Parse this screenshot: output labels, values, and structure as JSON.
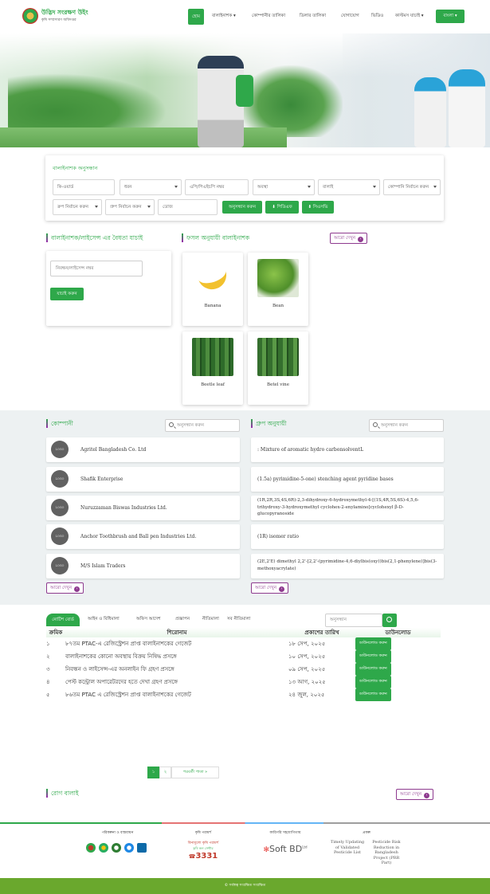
{
  "header": {
    "logo_title": "উদ্ভিদ সংরক্ষণ উইং",
    "logo_subtitle": "কৃষি সম্প্রসারণ অধিদপ্তর",
    "nav": [
      {
        "label": "হোম",
        "active": true
      },
      {
        "label": "বালাইনাশক ▾"
      },
      {
        "label": "কোম্পানীর তালিকা"
      },
      {
        "label": "ডিলার তালিকা"
      },
      {
        "label": "যোগাযোগ"
      },
      {
        "label": "ভিডিও"
      },
      {
        "label": "কাস্টমস যাচাই ▾"
      }
    ],
    "lang_button": "বাংলা ▾"
  },
  "search_panel": {
    "title": "বালাইনাশক অনুসন্ধান",
    "row1": [
      {
        "value": "কি-ওয়ার্ড",
        "dropdown": false
      },
      {
        "value": "ধরন",
        "dropdown": true
      },
      {
        "value": "এপি/পিএইচপি নম্বর",
        "dropdown": false
      },
      {
        "value": "অবস্থা",
        "dropdown": true
      },
      {
        "value": "বালাই",
        "dropdown": true
      },
      {
        "value": "কোম্পানি নির্বাচন করুন",
        "dropdown": true
      }
    ],
    "row2": [
      {
        "value": "ক্রপ নির্বাচন করুন",
        "dropdown": true
      },
      {
        "value": "গ্রুপ নির্বাচন করুন",
        "dropdown": true
      },
      {
        "value": "ডোজ",
        "dropdown": false
      }
    ],
    "search_button": "অনুসন্ধান করুন",
    "pdf_button": "পিডিএফ",
    "csv_button": "সিএসভি"
  },
  "verify": {
    "title": "বালাইনাশক/লাইসেন্স এর বৈধতা যাচাই",
    "placeholder": "নিবন্ধন/লাইসেন্স নম্বর",
    "button": "যাচাই করুন"
  },
  "crops": {
    "title": "ফসল অনুযায়ী বালাইনাশক",
    "more": "আরো দেখুন",
    "items": [
      {
        "name": "Banana",
        "icon": "banana-icon"
      },
      {
        "name": "Bean",
        "icon": "bean-icon"
      },
      {
        "name": "Beetle leaf",
        "icon": "beetle-leaf-icon"
      },
      {
        "name": "Betel vine",
        "icon": "betel-vine-icon"
      }
    ]
  },
  "companies": {
    "title": "কোম্পানী",
    "search_placeholder": "অনুসন্ধান করুন",
    "logo_label": "LOGO",
    "items": [
      "Agritel Bangladesh Co. Ltd",
      "Shafik Enterprise",
      "Nuruzzaman Biswas Industries Ltd.",
      "Anchor Toothbrush and Ball pen Industries Ltd.",
      "M/S Islam Traders"
    ],
    "more": "আরো দেখুন"
  },
  "groups": {
    "title": "গ্রুপ অনুযায়ী",
    "search_placeholder": "অনুসন্ধান করুন",
    "items": [
      ": Mixture of aromatic hydro carbonsolventL",
      "(1.5a) pyrimidine-5-one) stenching agent pyridine bases",
      "(1R,2R,3S,4S,6R)-2,3-dihydroxy-6-hydroxymethyl-4-[(1S,4R,5S,6S)-4,5,6-trihydroxy-3-hydroxymethyl cyclohex-2-enylamino]cyclohexyl β-D-glucopyranoside",
      "(1R) isomer ratio",
      "(2E,2'E) dimethyl 2,2'-[2,2'-(pyrimidine-4,6-diylbis(oxy))bis(2,1-phenylene)]bis(3-methoxyacrylate)"
    ],
    "more": "আরো দেখুন"
  },
  "notices": {
    "tabs": [
      "নোটিশ বোর্ড",
      "আইন ও বিধিমালা",
      "অফিস আদেশ",
      "প্রজ্ঞাপন",
      "নীতিমালা",
      "সব নীতিমালা"
    ],
    "search_placeholder": "অনুসন্ধান",
    "columns": [
      "ক্রমিক",
      "শিরোনাম",
      "প্রকাশের তারিখ",
      "ডাউনলোড"
    ],
    "rows": [
      {
        "no": "১",
        "title": "৮৭তম PTAC-এ রেজিস্ট্রেশন প্রাপ্ত বালাইনাশকের গেজেট",
        "date": "১৮ সেপ, ২০২৫"
      },
      {
        "no": "২",
        "title": "বালাইনাশকের কোনো অবস্থায় বিক্রয় নিষিদ্ধ প্রসঙ্গে",
        "date": "১০ সেপ, ২০২৫"
      },
      {
        "no": "৩",
        "title": "নিবন্ধন ও লাইসেন্স-এর অনলাইন ফি গ্রহণ প্রসঙ্গে",
        "date": "০৯ সেপ, ২০২৫"
      },
      {
        "no": "৪",
        "title": "পেস্ট কন্ট্রোল অপারেটরদের হতে দেখা গ্রহণ প্রসঙ্গে",
        "date": "১৩ আগ, ২০২৫"
      },
      {
        "no": "৫",
        "title": "৮৬তম PTAC এ রেজিস্ট্রেশন প্রাপ্ত বালাইনাশকের গেজেট",
        "date": "২৪ জুল, ২০২৫"
      }
    ],
    "download_label": "ডাউনলোড করুন",
    "pages": [
      "১",
      "২",
      "পরবর্তী পাতা »"
    ]
  },
  "diseases": {
    "title": "রোগ বালাই",
    "more": "আরো দেখুন"
  },
  "footer": {
    "col1_title": "পরিকল্পনা ও বাস্তবায়ন",
    "col2_title": "কৃষি পরামর্শ",
    "col2_sub": "বিনামূল্যে কৃষি পরামর্শ",
    "col2_sub2": "কৃষি কল সেন্টার",
    "call_number": "3331",
    "col3_title": "কারিগরি সহযোগিতায়",
    "softbd": "Soft BD",
    "softbd_suffix": "Ltd",
    "col4_title": "প্রকল্প",
    "project1": "Timely Updating of Validated Pesticide List",
    "project2": "Pesticide Risk Reduction in Bangladesh Project (PRR Part)",
    "copyright": "© সর্বস্বত্ব সংরক্ষিত সংরক্ষিত"
  },
  "colors": {
    "accent": "#2ea84a",
    "purple": "#8e3a8f",
    "footer_bar": "#6aa82d"
  }
}
